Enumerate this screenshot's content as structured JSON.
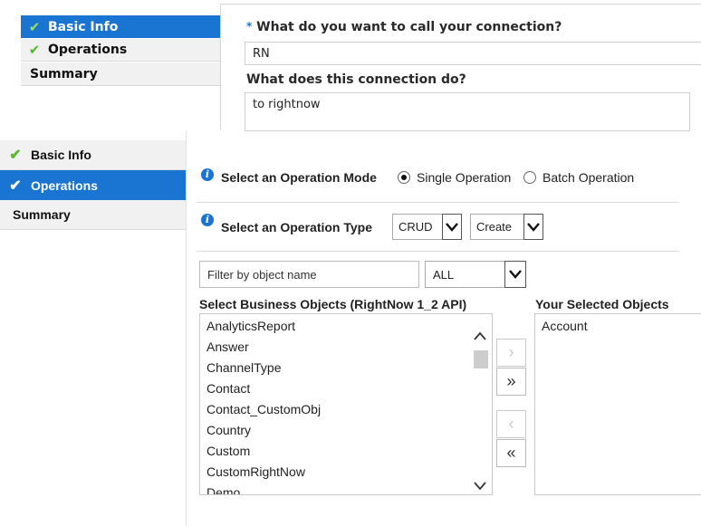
{
  "top": {
    "nav": [
      {
        "label": "Basic Info",
        "checked": true,
        "active": true
      },
      {
        "label": "Operations",
        "checked": true,
        "active": false
      },
      {
        "label": "Summary",
        "checked": false,
        "active": false
      }
    ],
    "required_mark": "*",
    "name_question": "What do you want to call your connection?",
    "name_value": "RN",
    "desc_question": "What does this connection do?",
    "desc_value": "to rightnow"
  },
  "nav": [
    {
      "label": "Basic Info",
      "checked": true,
      "active": false
    },
    {
      "label": "Operations",
      "checked": true,
      "active": true
    },
    {
      "label": "Summary",
      "checked": false,
      "active": false
    }
  ],
  "operation_mode": {
    "label": "Select an Operation Mode",
    "options": [
      "Single Operation",
      "Batch Operation"
    ],
    "selected": "Single Operation"
  },
  "operation_type": {
    "label": "Select an Operation Type",
    "category_value": "CRUD",
    "action_value": "Create"
  },
  "filter": {
    "placeholder": "Filter by object name",
    "scope_value": "ALL"
  },
  "business_objects": {
    "title": "Select Business Objects (RightNow 1_2 API)",
    "items": [
      "AnalyticsReport",
      "Answer",
      "ChannelType",
      "Contact",
      "Contact_CustomObj",
      "Country",
      "Custom",
      "CustomRightNow",
      "Demo"
    ]
  },
  "selected_objects": {
    "title": "Your Selected Objects",
    "items": [
      "Account"
    ]
  },
  "move_buttons": {
    "add_one": "›",
    "add_all": "»",
    "remove_one": "‹",
    "remove_all": "«"
  },
  "colors": {
    "accent": "#1a74d2",
    "check_green": "#59b82e"
  }
}
